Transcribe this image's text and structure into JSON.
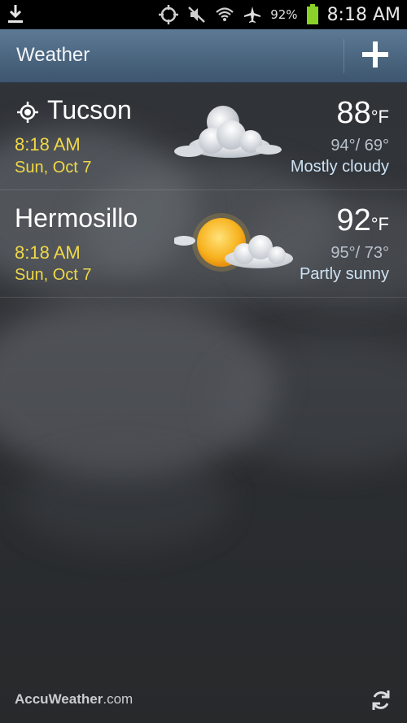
{
  "status_bar": {
    "battery": "92%",
    "time": "8:18 AM",
    "icons": [
      "download-icon",
      "gps-icon",
      "mute-icon",
      "wifi-icon",
      "airplane-icon",
      "battery-icon"
    ],
    "battery_color": "#8ad12a"
  },
  "action_bar": {
    "title": "Weather",
    "add_icon": "plus-icon"
  },
  "cities": [
    {
      "name": "Tucson",
      "is_current_location": true,
      "time": "8:18",
      "ampm": "AM",
      "date": "Sun, Oct 7",
      "temp": "88",
      "unit": "°F",
      "high_low": "94°/ 69°",
      "condition": "Mostly cloudy",
      "icon": "moon-cloud-icon"
    },
    {
      "name": "Hermosillo",
      "is_current_location": false,
      "time": "8:18",
      "ampm": "AM",
      "date": "Sun, Oct 7",
      "temp": "92",
      "unit": "°F",
      "high_low": "95°/ 73°",
      "condition": "Partly sunny",
      "icon": "sun-cloud-icon"
    }
  ],
  "footer": {
    "brand": "AccuWeather",
    "brand_suffix": ".com",
    "refresh_icon": "refresh-icon"
  },
  "colors": {
    "time_date": "#f0d846",
    "condition": "#cfe3f5",
    "action_bar": "#4c6781"
  }
}
